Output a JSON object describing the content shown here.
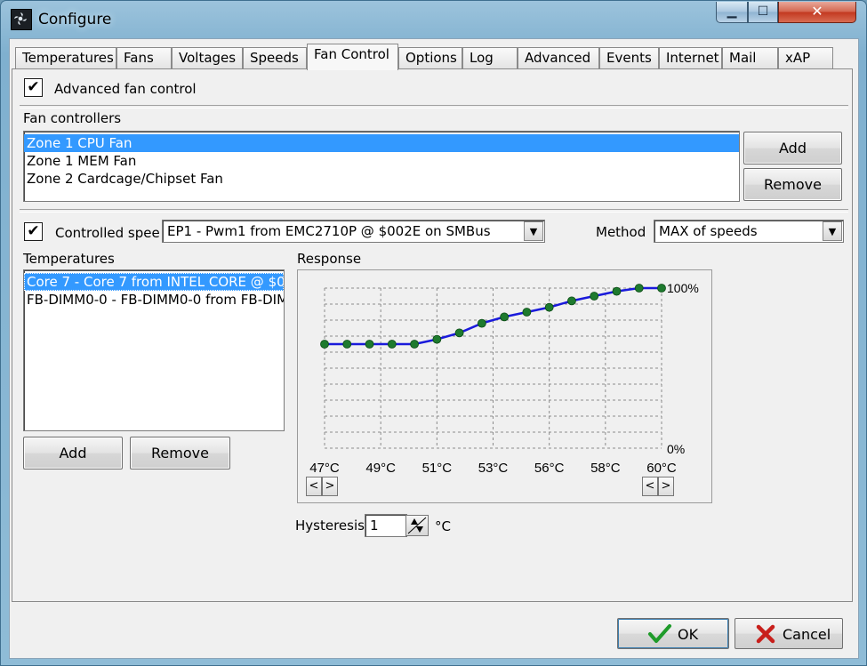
{
  "window": {
    "title": "Configure",
    "min_glyph": "▁",
    "max_glyph": "☐",
    "close_glyph": "✕"
  },
  "tabs": [
    {
      "label": "Temperatures"
    },
    {
      "label": "Fans"
    },
    {
      "label": "Voltages"
    },
    {
      "label": "Speeds"
    },
    {
      "label": "Fan Control"
    },
    {
      "label": "Options"
    },
    {
      "label": "Log"
    },
    {
      "label": "Advanced"
    },
    {
      "label": "Events"
    },
    {
      "label": "Internet"
    },
    {
      "label": "Mail"
    },
    {
      "label": "xAP"
    }
  ],
  "active_tab": "Fan Control",
  "fan_control": {
    "advanced_checkbox_label": "Advanced fan control",
    "advanced_checked": true,
    "check_glyph": "✔",
    "controllers_label": "Fan controllers",
    "controllers": [
      {
        "label": "Zone 1 CPU Fan",
        "selected": true
      },
      {
        "label": "Zone 1 MEM Fan",
        "selected": false
      },
      {
        "label": "Zone 2 Cardcage/Chipset Fan",
        "selected": false
      }
    ],
    "add_label": "Add",
    "remove_label": "Remove",
    "controlled_speed_label": "Controlled spee",
    "controlled_speed_checked": true,
    "speed_source": "EP1 - Pwm1 from EMC2710P @ $002E on SMBus",
    "method_label": "Method",
    "method_value": "MAX of speeds",
    "dropdown_glyph": "▼",
    "temperatures_label": "Temperatures",
    "temperatures": [
      {
        "label": "Core 7 - Core 7 from INTEL CORE @ $0",
        "selected": true
      },
      {
        "label": "FB-DIMM0-0 - FB-DIMM0-0 from FB-DIM",
        "selected": false
      }
    ],
    "temp_add_label": "Add",
    "temp_remove_label": "Remove",
    "response_label": "Response",
    "hysteresis_label": "Hysteresis",
    "hysteresis_value": "1",
    "hysteresis_unit": "°C",
    "scroll_left_glyph": "<",
    "scroll_right_glyph": ">"
  },
  "chart_data": {
    "type": "line",
    "x_tick_labels": [
      "47°C",
      "49°C",
      "51°C",
      "53°C",
      "56°C",
      "58°C",
      "60°C"
    ],
    "y_tick_labels": [
      "100%",
      "0%"
    ],
    "ylim": [
      0,
      100
    ],
    "grid": true,
    "line_color": "#1a1adb",
    "point_color": "#1e7a2e",
    "values": [
      65,
      65,
      65,
      65,
      65,
      68,
      72,
      78,
      82,
      85,
      88,
      92,
      95,
      98,
      100,
      100
    ]
  },
  "buttons": {
    "ok_label": "OK",
    "cancel_label": "Cancel"
  }
}
